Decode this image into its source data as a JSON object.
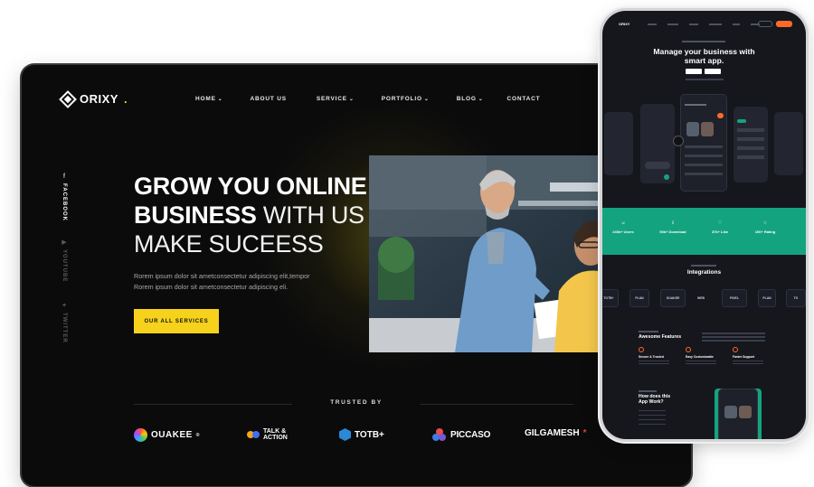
{
  "desktop": {
    "logo": {
      "name": "ORIXY",
      "dot": "."
    },
    "nav": [
      {
        "label": "HOME",
        "chevron": true
      },
      {
        "label": "ABOUT US",
        "chevron": false
      },
      {
        "label": "SERVICE",
        "chevron": true
      },
      {
        "label": "PORTFOLIO",
        "chevron": true
      },
      {
        "label": "BLOG",
        "chevron": true
      },
      {
        "label": "CONTACT",
        "chevron": false
      }
    ],
    "social": [
      {
        "label": "FACEBOOK",
        "icon": "facebook-icon",
        "glyph": "f"
      },
      {
        "label": "YOUTUBE",
        "icon": "youtube-icon",
        "glyph": "▶"
      },
      {
        "label": "TWITTER",
        "icon": "twitter-icon",
        "glyph": "✦"
      }
    ],
    "hero": {
      "line1_bold": "GROW YOU ONLINE",
      "line2_bold": "BUSINESS",
      "line2_light": " WITH US &",
      "line3_light": "MAKE SUCEESS",
      "description": "Rorem ipsum dolor sit ametconsectetur adipiscing elit,tempor Rorem ipsum dolor sit ametconsectetur adipiscing eli.",
      "button": "OUR ALL SERVICES"
    },
    "trusted_label": "TRUSTED BY",
    "brands": [
      "OUAKEE",
      "TALK & ACTION",
      "TOTB+",
      "PICCASO",
      "GILGAMESH"
    ],
    "brand_marks": {
      "ouakee": "®",
      "gilgamesh": "*"
    }
  },
  "phone": {
    "hero_title_1": "Manage your business with",
    "hero_title_2": "smart app.",
    "stores": [
      "App Store",
      "Google Play"
    ],
    "stats": [
      {
        "value": "240k+ Users"
      },
      {
        "value": "50k+ Download"
      },
      {
        "value": "37k+ Like"
      },
      {
        "value": "100+ Rating"
      }
    ],
    "integrations_title": "Integrations",
    "features_title": "Awesome Features",
    "features": [
      "Secure & Trusted",
      "Easy Customizable",
      "Faster Support"
    ],
    "how_title_1": "How does this",
    "how_title_2": "App Work?"
  },
  "colors": {
    "accent": "#f6d21c",
    "orange": "#ff6a2a",
    "green": "#14a37f",
    "dark": "#0b0b0c"
  }
}
